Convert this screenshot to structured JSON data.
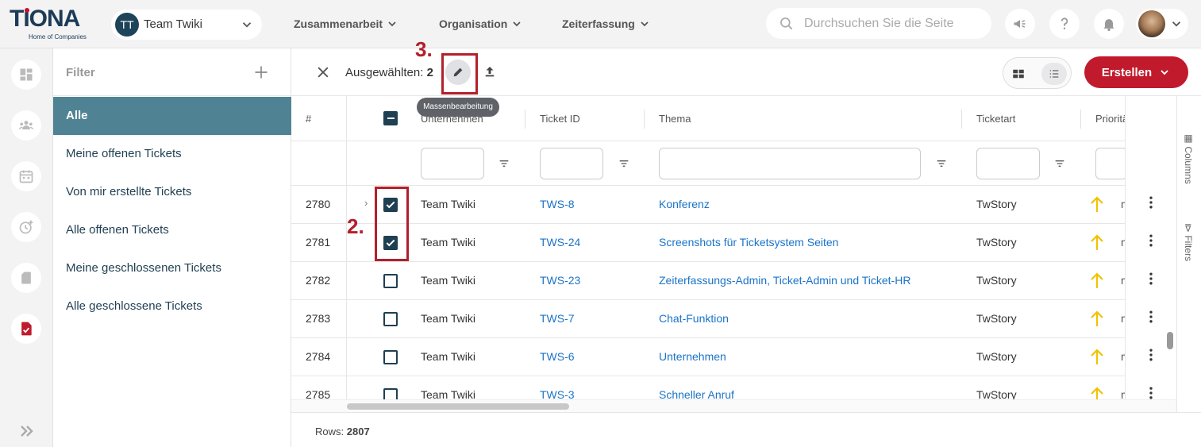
{
  "app": {
    "logo_text": "TIONA",
    "logo_subtitle": "Home of Companies"
  },
  "team": {
    "avatar_initials": "TT",
    "name": "Team Twiki"
  },
  "nav": [
    {
      "label": "Zusammenarbeit"
    },
    {
      "label": "Organisation"
    },
    {
      "label": "Zeiterfassung"
    }
  ],
  "search": {
    "placeholder": "Durchsuchen Sie die Seite"
  },
  "filter_panel": {
    "title": "Filter",
    "items": [
      {
        "label": "Alle",
        "active": true
      },
      {
        "label": "Meine offenen Tickets"
      },
      {
        "label": "Von mir erstellte Tickets"
      },
      {
        "label": "Alle offenen Tickets"
      },
      {
        "label": "Meine geschlossenen Tickets"
      },
      {
        "label": "Alle geschlossene Tickets"
      }
    ]
  },
  "toolbar": {
    "selected_label": "Ausgewählten:",
    "selected_count": "2",
    "edit_tooltip": "Massenbearbeitung",
    "create_label": "Erstellen"
  },
  "grid": {
    "headers": {
      "num": "#",
      "company": "Unternehmen",
      "ticket_id": "Ticket ID",
      "topic": "Thema",
      "type": "Ticketart",
      "priority": "Priorität"
    },
    "rows": [
      {
        "num": "2780",
        "company": "Team Twiki",
        "ticket_id": "TWS-8",
        "topic": "Konferenz",
        "type": "TwStory",
        "checked": true,
        "prio_text": "m"
      },
      {
        "num": "2781",
        "company": "Team Twiki",
        "ticket_id": "TWS-24",
        "topic": "Screenshots für Ticketsystem Seiten",
        "type": "TwStory",
        "checked": true,
        "prio_text": "m"
      },
      {
        "num": "2782",
        "company": "Team Twiki",
        "ticket_id": "TWS-23",
        "topic": "Zeiterfassungs-Admin, Ticket-Admin und Ticket-HR",
        "type": "TwStory",
        "checked": false,
        "prio_text": "m"
      },
      {
        "num": "2783",
        "company": "Team Twiki",
        "ticket_id": "TWS-7",
        "topic": "Chat-Funktion",
        "type": "TwStory",
        "checked": false,
        "prio_text": "m"
      },
      {
        "num": "2784",
        "company": "Team Twiki",
        "ticket_id": "TWS-6",
        "topic": "Unternehmen",
        "type": "TwStory",
        "checked": false,
        "prio_text": "m"
      },
      {
        "num": "2785",
        "company": "Team Twiki",
        "ticket_id": "TWS-3",
        "topic": "Schneller Anruf",
        "type": "TwStory",
        "checked": false,
        "prio_text": "m"
      }
    ],
    "side_panels": {
      "columns": "Columns",
      "filters": "Filters"
    }
  },
  "footer": {
    "rows_label": "Rows:",
    "rows_count": "2807"
  },
  "annotations": {
    "step2": "2.",
    "step3": "3."
  },
  "colors": {
    "brand_navy": "#1d3b57",
    "accent_red": "#c01a2c",
    "active_filter": "#4f8394",
    "link_blue": "#1a73c8",
    "priority_up": "#f2c200"
  }
}
